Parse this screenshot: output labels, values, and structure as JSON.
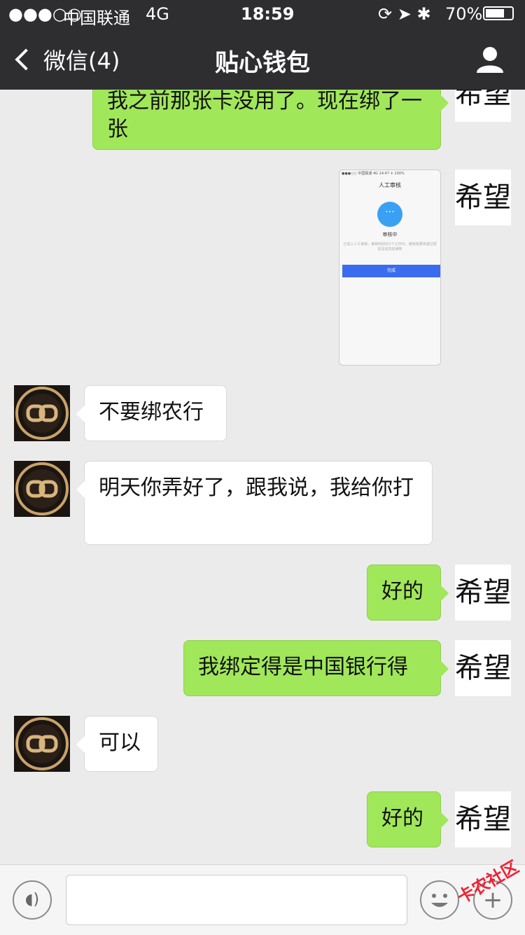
{
  "status": {
    "signal": "●●●○○",
    "carrier": "中国联通",
    "network": "4G",
    "time": "18:59",
    "battery": "70%"
  },
  "nav": {
    "back_label": "微信(4)",
    "title": "贴心钱包"
  },
  "messages": {
    "m1": "我之前那张卡没用了。现在绑了一张",
    "m3": "不要绑农行",
    "m4": "明天你弄好了，跟我说，我给你打",
    "m5": "好的",
    "m6": "我绑定得是中国银行得",
    "m7": "可以",
    "m8": "好的"
  },
  "my_avatar_text": "希望",
  "screenshot": {
    "status": "●●●○○ 中国联通 4G  14:47  ✈ 100%",
    "title": "人工审核",
    "icon": "···",
    "label": "审核中",
    "desc": "已进入人工审核，审核时间约1个工作日，审核结果将通过短信及站内信通知",
    "button": "完成"
  },
  "watermark": "卡农社区"
}
